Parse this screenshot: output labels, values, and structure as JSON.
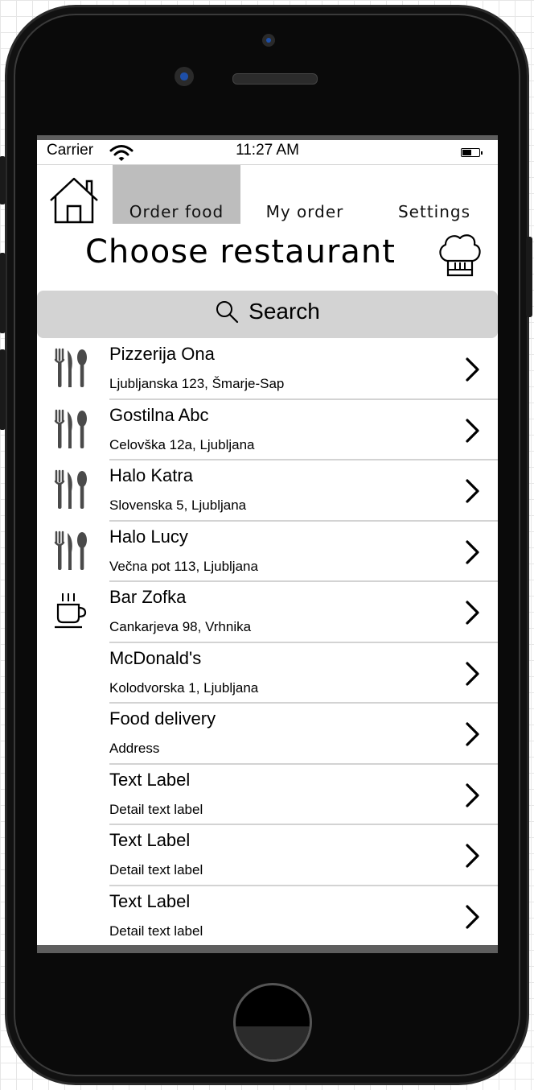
{
  "status_bar": {
    "carrier": "Carrier",
    "time": "11:27 AM"
  },
  "nav": {
    "tabs": [
      {
        "label": "Order food",
        "active": true
      },
      {
        "label": "My order",
        "active": false
      },
      {
        "label": "Settings",
        "active": false
      }
    ]
  },
  "header": {
    "title": "Choose restaurant"
  },
  "search": {
    "label": "Search"
  },
  "restaurants": [
    {
      "title": "Pizzerija Ona",
      "subtitle": "Ljubljanska 123, Šmarje-Sap",
      "icon": "cutlery-icon"
    },
    {
      "title": "Gostilna Abc",
      "subtitle": "Celovška 12a, Ljubljana",
      "icon": "cutlery-icon"
    },
    {
      "title": "Halo Katra",
      "subtitle": "Slovenska 5, Ljubljana",
      "icon": "cutlery-icon"
    },
    {
      "title": "Halo Lucy",
      "subtitle": "Večna pot 113, Ljubljana",
      "icon": "cutlery-icon"
    },
    {
      "title": "Bar Zofka",
      "subtitle": "Cankarjeva 98, Vrhnika",
      "icon": "coffee-cup-icon"
    },
    {
      "title": "McDonald's",
      "subtitle": "Kolodvorska 1, Ljubljana",
      "icon": ""
    },
    {
      "title": "Food delivery",
      "subtitle": "Address",
      "icon": ""
    },
    {
      "title": "Text Label",
      "subtitle": "Detail text label",
      "icon": ""
    },
    {
      "title": "Text Label",
      "subtitle": "Detail text label",
      "icon": ""
    },
    {
      "title": "Text Label",
      "subtitle": "Detail text label",
      "icon": ""
    }
  ],
  "colors": {
    "active_tab": "#bdbdbd",
    "search_bg": "#d3d3d3",
    "bezel": "#0a0a0a"
  }
}
